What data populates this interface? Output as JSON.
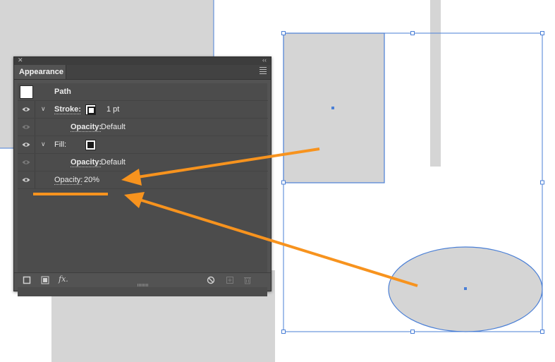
{
  "panel": {
    "title": "Appearance",
    "close_glyph": "✕",
    "collapse_glyph": "‹‹",
    "rows": [
      {
        "label": "Path"
      },
      {
        "label": "Stroke:",
        "value": "1 pt"
      },
      {
        "label": "Opacity:",
        "value": "Default"
      },
      {
        "label": "Fill:"
      },
      {
        "label": "Opacity:",
        "value": "Default"
      },
      {
        "label": "Opacity:",
        "value": "20%"
      }
    ],
    "chevron_glyph": "∨",
    "fx_label": "fx."
  },
  "icons": {
    "visibility": "eye-icon",
    "stroke": "stroke-swatch-icon",
    "fill": "fill-swatch-icon",
    "add_stroke": "add-new-stroke-icon",
    "add_fill": "add-new-fill-icon",
    "fx": "add-effect-icon",
    "clear": "clear-appearance-icon",
    "duplicate": "duplicate-item-icon",
    "delete": "delete-item-icon"
  },
  "colors": {
    "panel_bg": "#535353",
    "shape_fill": "#d5d5d5",
    "selection": "#4a7fd6",
    "annotation": "#f7931e"
  }
}
